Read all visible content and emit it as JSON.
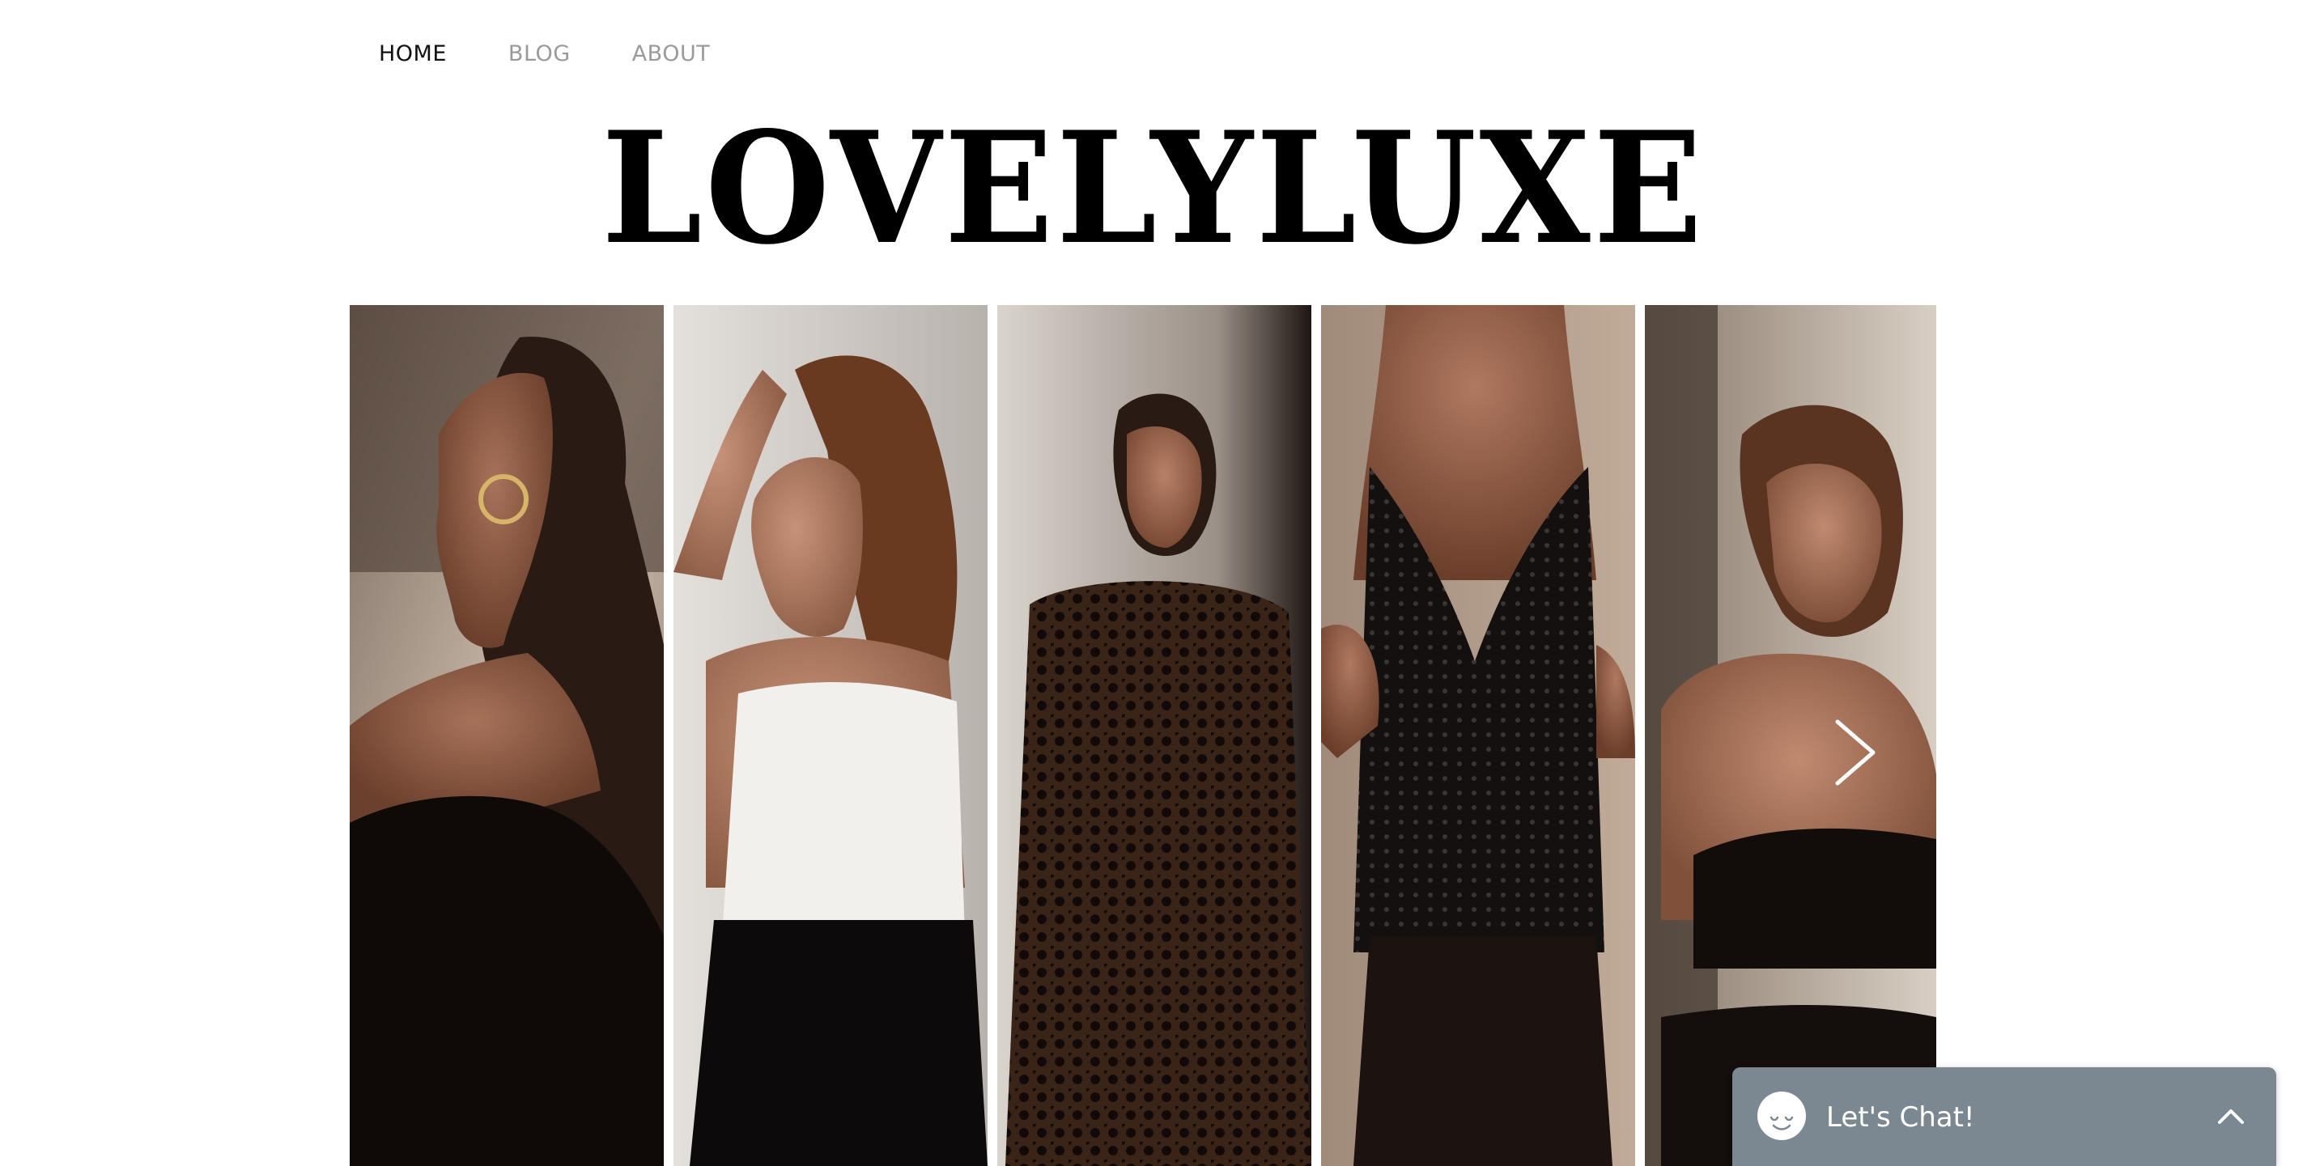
{
  "nav": {
    "items": [
      {
        "label": "HOME",
        "active": true
      },
      {
        "label": "BLOG",
        "active": false
      },
      {
        "label": "ABOUT",
        "active": false
      }
    ]
  },
  "site": {
    "logo": "LOVELYLUXE"
  },
  "gallery": {
    "photos": [
      {
        "subject": "woman in black top, profile with hoop earring"
      },
      {
        "subject": "woman in white camisole and black jeans, back view"
      },
      {
        "subject": "woman in black lace jumpsuit"
      },
      {
        "subject": "woman in black sequin bodysuit"
      },
      {
        "subject": "woman in black tie top with ponytail"
      }
    ],
    "next_icon": "chevron-right-icon"
  },
  "chat": {
    "label": "Let's Chat!",
    "avatar_icon": "chat-smile-icon",
    "toggle_icon": "chevron-up-icon",
    "background": "#7b8791"
  },
  "colors": {
    "nav_active": "#111111",
    "nav_inactive": "#9a9a9a",
    "logo": "#000000"
  }
}
